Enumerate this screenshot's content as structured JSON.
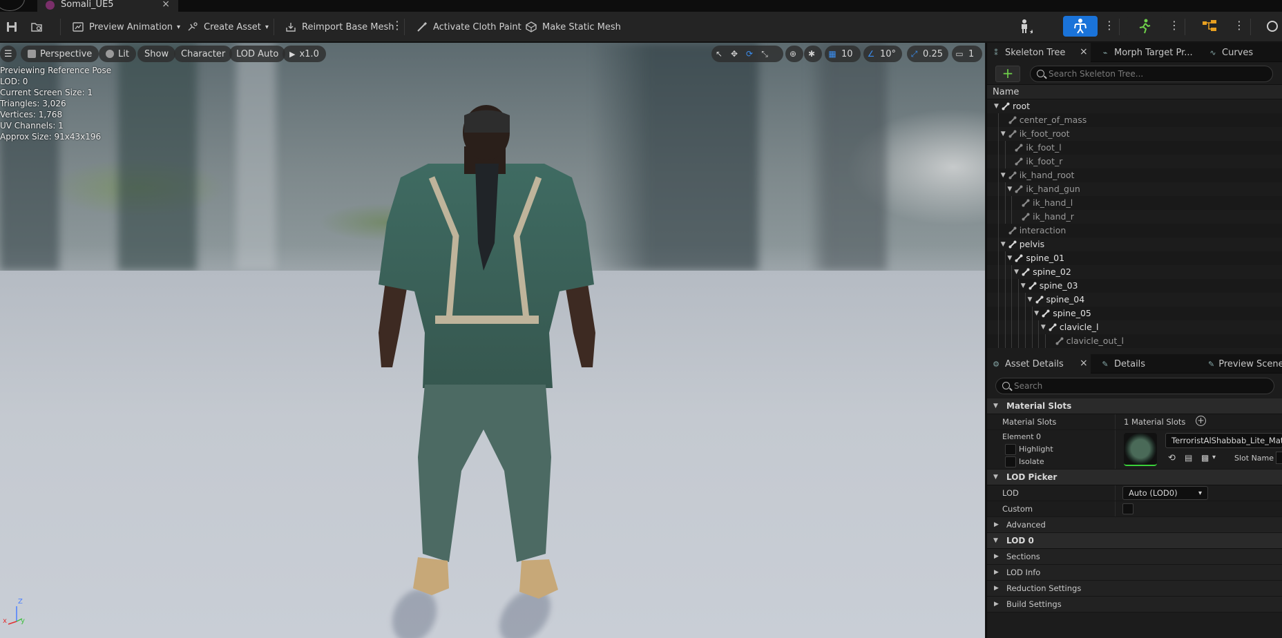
{
  "window": {
    "tab_title": "Somali_UE5",
    "tab_close": "×"
  },
  "toolbar": {
    "preview_animation": "Preview Animation",
    "create_asset": "Create Asset",
    "reimport_base_mesh": "Reimport Base Mesh",
    "activate_cloth_paint": "Activate Cloth Paint",
    "make_static_mesh": "Make Static Mesh",
    "more": "⋮"
  },
  "viewport": {
    "perspective": "Perspective",
    "lit": "Lit",
    "show": "Show",
    "character": "Character",
    "lod_auto": "LOD Auto",
    "playback": "x1.0",
    "grid_snap": "10",
    "rotation_snap": "10°",
    "scale_snap": "0.25",
    "camera_speed": "1",
    "info": [
      "Previewing Reference Pose",
      "LOD: 0",
      "Current Screen Size: 1",
      "Triangles: 3,026",
      "Vertices: 1,768",
      "UV Channels: 1",
      "Approx Size: 91x43x196"
    ],
    "axis_z": "Z",
    "axis_x": "x",
    "axis_y": "y"
  },
  "skeleton_panel": {
    "tabs": [
      "Skeleton Tree",
      "Morph Target Pr...",
      "Curves"
    ],
    "close": "×",
    "search_placeholder": "Search Skeleton Tree...",
    "column_name": "Name",
    "bones": [
      {
        "name": "root",
        "depth": 0,
        "expandable": true,
        "active": true
      },
      {
        "name": "center_of_mass",
        "depth": 1,
        "expandable": false,
        "active": false
      },
      {
        "name": "ik_foot_root",
        "depth": 1,
        "expandable": true,
        "active": false
      },
      {
        "name": "ik_foot_l",
        "depth": 2,
        "expandable": false,
        "active": false
      },
      {
        "name": "ik_foot_r",
        "depth": 2,
        "expandable": false,
        "active": false
      },
      {
        "name": "ik_hand_root",
        "depth": 1,
        "expandable": true,
        "active": false
      },
      {
        "name": "ik_hand_gun",
        "depth": 2,
        "expandable": true,
        "active": false
      },
      {
        "name": "ik_hand_l",
        "depth": 3,
        "expandable": false,
        "active": false
      },
      {
        "name": "ik_hand_r",
        "depth": 3,
        "expandable": false,
        "active": false
      },
      {
        "name": "interaction",
        "depth": 1,
        "expandable": false,
        "active": false
      },
      {
        "name": "pelvis",
        "depth": 1,
        "expandable": true,
        "active": true
      },
      {
        "name": "spine_01",
        "depth": 2,
        "expandable": true,
        "active": true
      },
      {
        "name": "spine_02",
        "depth": 3,
        "expandable": true,
        "active": true
      },
      {
        "name": "spine_03",
        "depth": 4,
        "expandable": true,
        "active": true
      },
      {
        "name": "spine_04",
        "depth": 5,
        "expandable": true,
        "active": true
      },
      {
        "name": "spine_05",
        "depth": 6,
        "expandable": true,
        "active": true
      },
      {
        "name": "clavicle_l",
        "depth": 7,
        "expandable": true,
        "active": true
      },
      {
        "name": "clavicle_out_l",
        "depth": 8,
        "expandable": false,
        "active": false
      }
    ]
  },
  "details_panel": {
    "tabs": [
      "Asset Details",
      "Details",
      "Preview Scene"
    ],
    "close": "×",
    "search_placeholder": "Search",
    "material_slots_section": "Material Slots",
    "material_slots_label": "Material Slots",
    "material_slots_value": "1 Material Slots",
    "element_label": "Element 0",
    "highlight": "Highlight",
    "isolate": "Isolate",
    "material_name": "TerroristAlShabbab_Lite_Mat_Inst",
    "slot_name_label": "Slot Name",
    "lod_picker_section": "LOD Picker",
    "lod_label": "LOD",
    "lod_value": "Auto (LOD0)",
    "custom_label": "Custom",
    "advanced": "Advanced",
    "lod0_section": "LOD 0",
    "sections": "Sections",
    "lod_info": "LOD Info",
    "reduction_settings": "Reduction Settings",
    "build_settings": "Build Settings"
  },
  "colors": {
    "accent": "#1a73d9",
    "add_green": "#6fd14a",
    "snap_blue": "#3b8ef0"
  }
}
